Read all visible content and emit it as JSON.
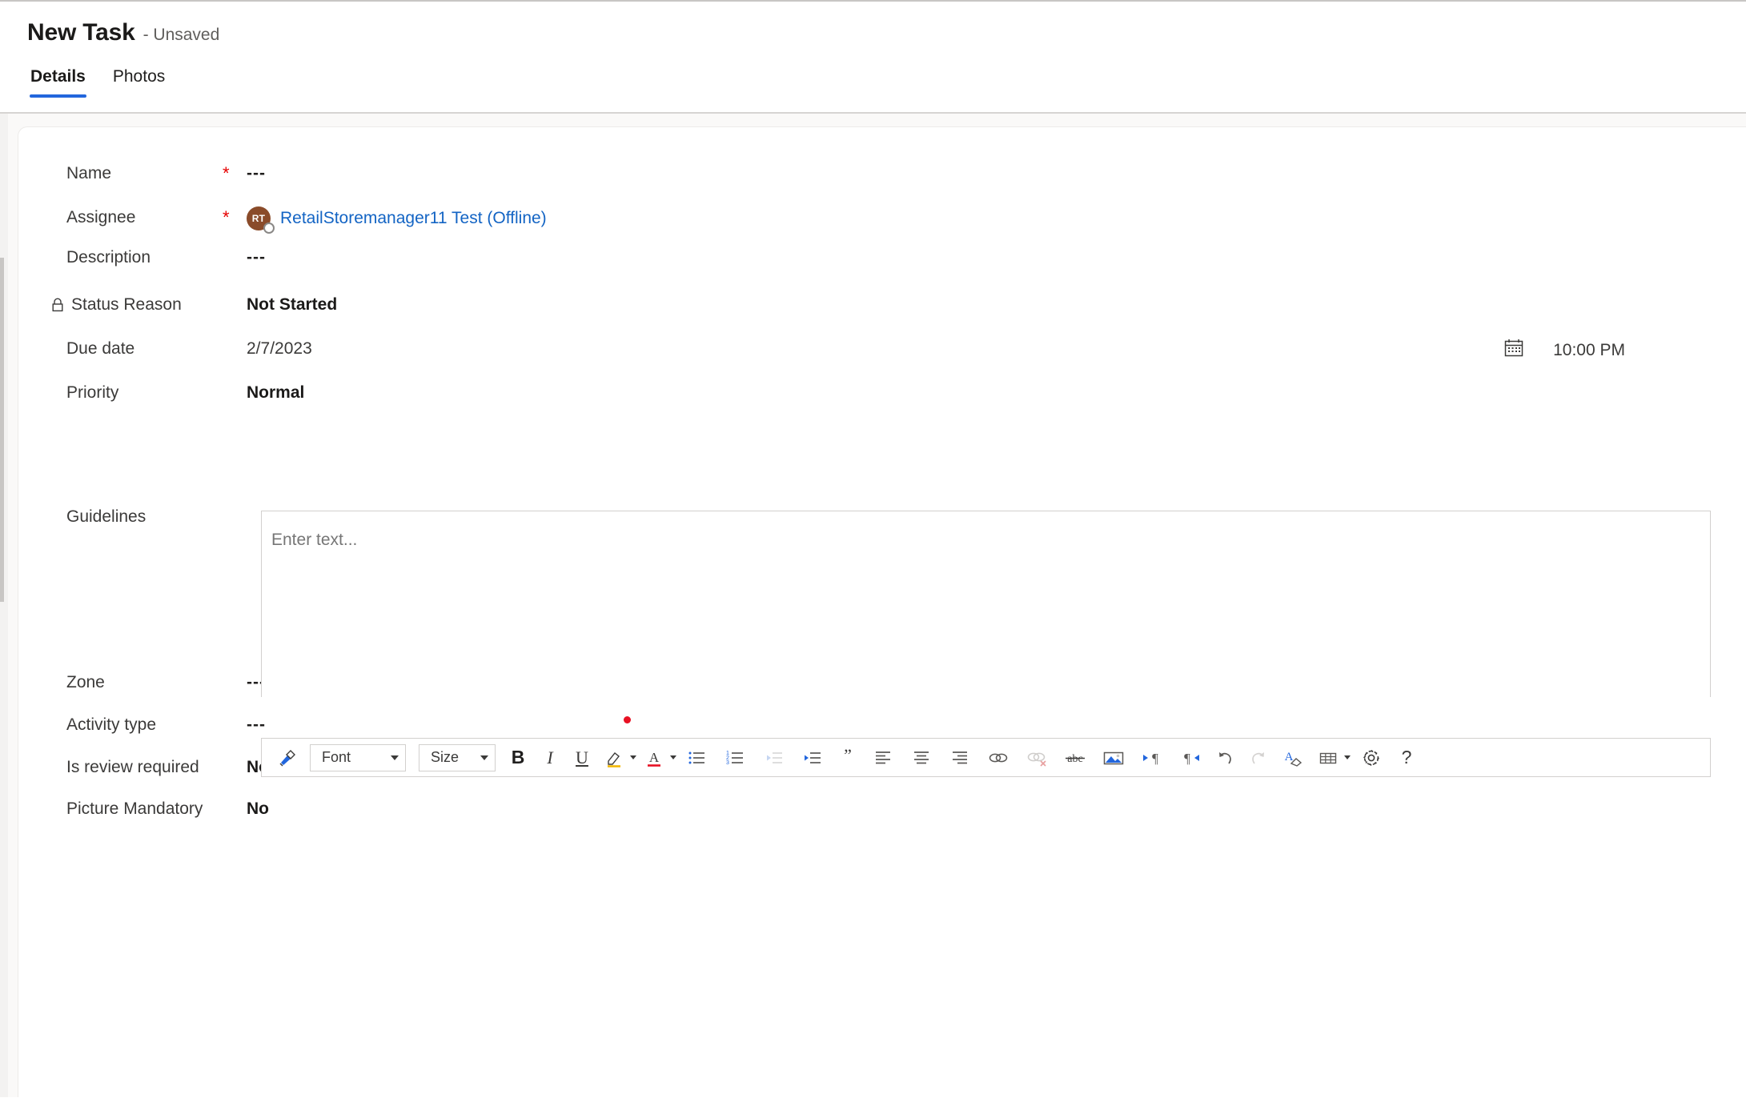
{
  "header": {
    "title": "New Task",
    "subtitle": "- Unsaved",
    "tabs": [
      {
        "label": "Details",
        "active": true
      },
      {
        "label": "Photos",
        "active": false
      }
    ]
  },
  "form": {
    "fields": [
      {
        "label": "Name",
        "required": true,
        "locked": false,
        "value": "---",
        "style": "dashes"
      },
      {
        "label": "Assignee",
        "required": true,
        "locked": false,
        "value": "",
        "style": "person"
      },
      {
        "label": "Description",
        "required": false,
        "locked": false,
        "value": "---",
        "style": "dashes"
      },
      {
        "label": "Status Reason",
        "required": false,
        "locked": true,
        "value": "Not Started",
        "style": "strong"
      },
      {
        "label": "Due date",
        "required": false,
        "locked": false,
        "value": "2/7/2023",
        "style": "plain"
      },
      {
        "label": "Priority",
        "required": false,
        "locked": false,
        "value": "Normal",
        "style": "strong"
      },
      {
        "label": "Guidelines",
        "required": false,
        "locked": false,
        "value": "",
        "style": "editor"
      },
      {
        "label": "Zone",
        "required": false,
        "locked": false,
        "value": "---",
        "style": "dashes"
      },
      {
        "label": "Activity type",
        "required": false,
        "locked": false,
        "value": "---",
        "style": "dashes"
      },
      {
        "label": "Is review required",
        "required": false,
        "locked": false,
        "value": "No",
        "style": "strong"
      },
      {
        "label": "Picture Mandatory",
        "required": false,
        "locked": false,
        "value": "No",
        "style": "strong"
      }
    ],
    "required_marker": "*",
    "assignee": {
      "initials": "RT",
      "name": "RetailStoremanager11 Test (Offline)",
      "presence": "offline"
    },
    "due_time": "10:00 PM"
  },
  "editor": {
    "placeholder": "Enter text...",
    "font_label": "Font",
    "size_label": "Size",
    "buttons": [
      "format-painter",
      "font-family",
      "font-size",
      "bold",
      "italic",
      "underline",
      "highlight-color",
      "font-color",
      "bulleted-list",
      "numbered-list",
      "decrease-indent",
      "increase-indent",
      "blockquote",
      "align-left",
      "align-center",
      "align-right",
      "insert-link",
      "remove-link",
      "strikethrough",
      "insert-image",
      "left-to-right",
      "right-to-left",
      "undo",
      "redo",
      "clear-formatting",
      "insert-table",
      "settings",
      "help"
    ]
  },
  "colors": {
    "accent": "#2266dd",
    "link": "#1364c4",
    "required": "#e60000",
    "avatar_bg": "#8a4b2a",
    "page_bg": "#faf9f8",
    "marker_dot": "#e81123"
  }
}
